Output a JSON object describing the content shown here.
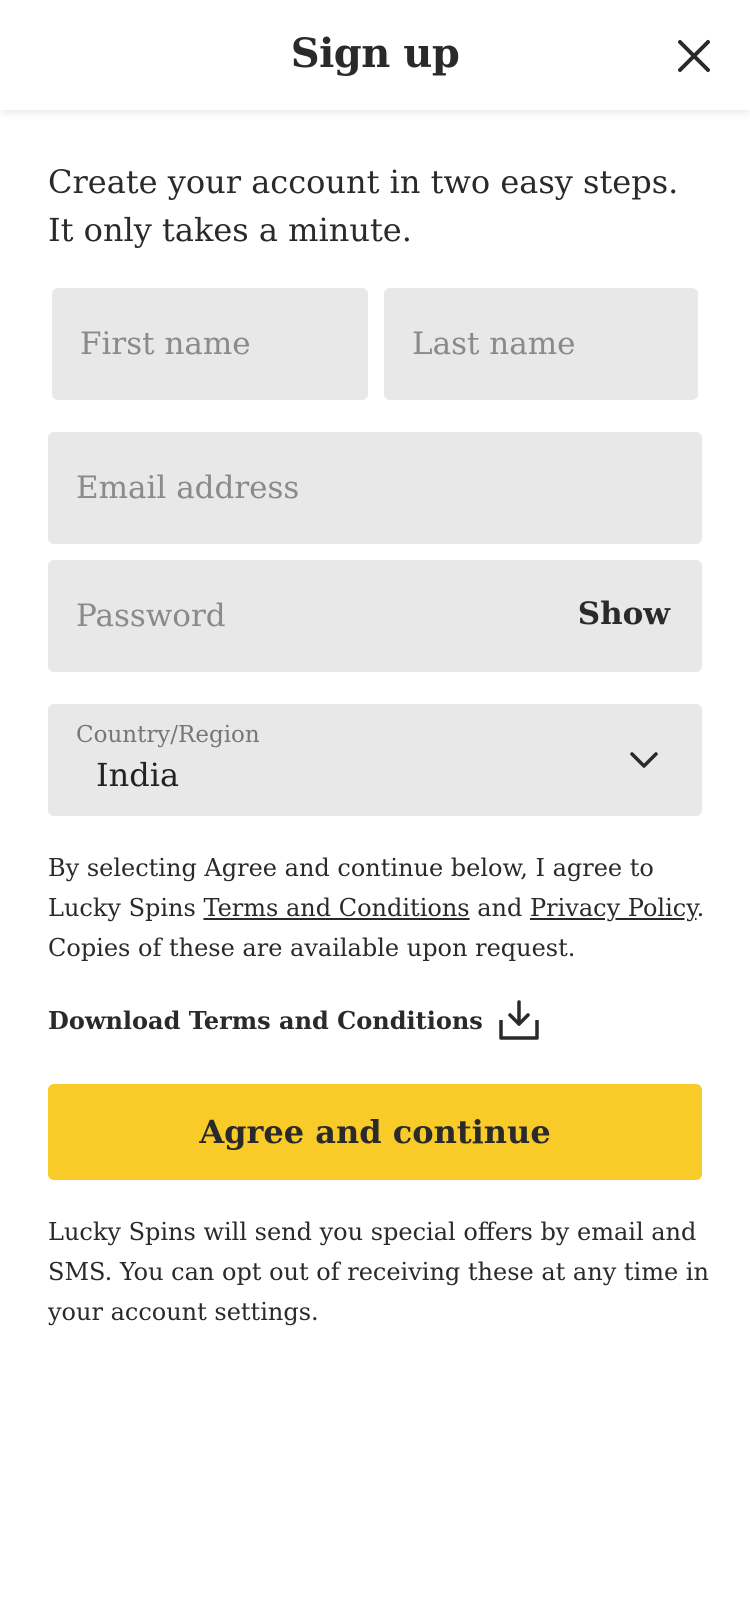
{
  "header": {
    "title": "Sign up",
    "close_icon": "close-icon"
  },
  "intro": "Create your account in two easy steps. It only takes a minute.",
  "form": {
    "first_name_placeholder": "First name",
    "last_name_placeholder": "Last name",
    "email_placeholder": "Email address",
    "password_placeholder": "Password",
    "show_label": "Show",
    "country_label": "Country/Region",
    "country_value": "India"
  },
  "legal": {
    "text_before": "By selecting Agree and continue below, I agree to Lucky Spins ",
    "terms_link": "Terms and Conditions",
    "text_middle": " and ",
    "privacy_link": "Privacy Policy",
    "text_after": ". Copies of these are available upon request."
  },
  "download": {
    "label": "Download Terms and Conditions",
    "icon": "download-icon"
  },
  "cta": {
    "label": "Agree and continue",
    "color": "#f8cb29"
  },
  "footnote": "Lucky Spins will send you special offers by email and SMS. You can opt out of receiving these at any time in your account settings."
}
